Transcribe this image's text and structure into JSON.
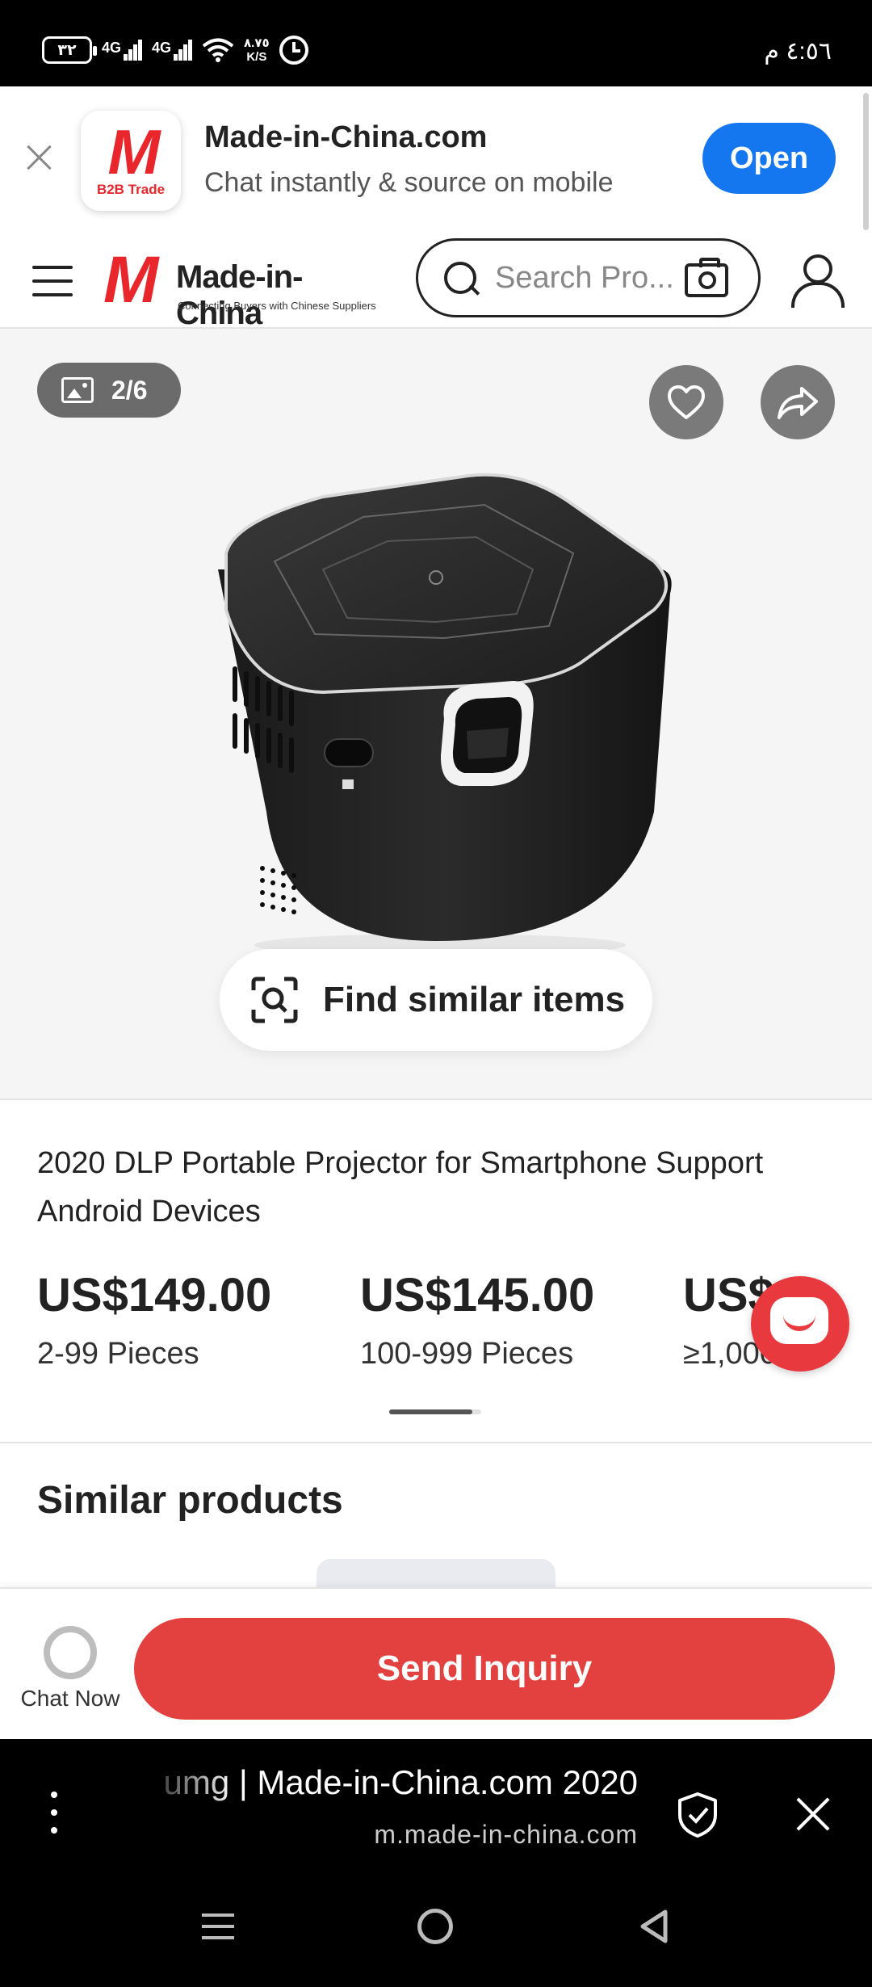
{
  "status_bar": {
    "battery": "٣٢",
    "signal_1": "4G",
    "signal_2": "4G",
    "speed_value": "٨.٧٥",
    "speed_unit": "K/S",
    "time": "٤:٥٦ م"
  },
  "app_banner": {
    "icon_caption": "B2B Trade",
    "title": "Made-in-China.com",
    "subtitle": "Chat instantly & source on mobile",
    "open_label": "Open"
  },
  "header": {
    "logo_mark": "M",
    "logo_text": "Made-in-China",
    "logo_tagline": "Connecting Buyers with Chinese Suppliers",
    "search_placeholder": "Search Pro..."
  },
  "gallery": {
    "counter": "2/6",
    "find_similar_label": "Find similar items"
  },
  "product": {
    "title": "2020 DLP Portable Projector for Smartphone Support Android Devices",
    "price_tiers": [
      {
        "price": "US$149.00",
        "quantity": "2-99 Pieces"
      },
      {
        "price": "US$145.00",
        "quantity": "100-999 Pieces"
      },
      {
        "price": "US$",
        "quantity": "≥1,000 Pi"
      }
    ],
    "tier_scroll_fraction": 0.9
  },
  "similar": {
    "title": "Similar products"
  },
  "action_bar": {
    "chat_now_label": "Chat Now",
    "send_inquiry_label": "Send Inquiry"
  },
  "browser": {
    "page_title": "umg | Made-in-China.com 2020",
    "url": "m.made-in-china.com"
  },
  "colors": {
    "brand_red": "#e8262c",
    "open_blue": "#1477f0",
    "inquiry_red": "#e3413f"
  }
}
